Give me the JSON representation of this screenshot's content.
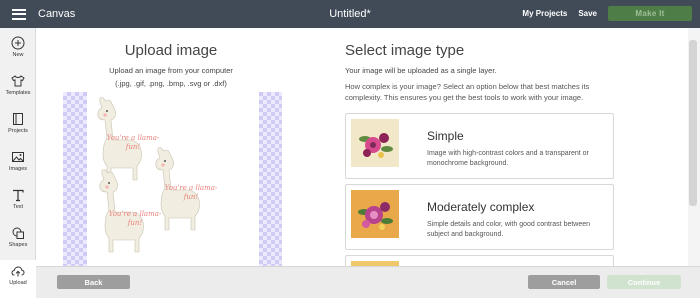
{
  "app": {
    "title": "Canvas",
    "document_title": "Untitled*"
  },
  "header": {
    "my_projects": "My Projects",
    "save": "Save",
    "make_it": "Make It"
  },
  "sidebar": {
    "items": [
      {
        "label": "New",
        "icon": "plus-circle-icon"
      },
      {
        "label": "Templates",
        "icon": "shirt-icon"
      },
      {
        "label": "Projects",
        "icon": "projects-icon"
      },
      {
        "label": "Images",
        "icon": "image-icon"
      },
      {
        "label": "Text",
        "icon": "text-icon"
      },
      {
        "label": "Shapes",
        "icon": "shapes-icon"
      },
      {
        "label": "Upload",
        "icon": "cloud-upload-icon"
      }
    ]
  },
  "upload": {
    "title": "Upload image",
    "subtitle": "Upload an image from your computer",
    "formats": "(.jpg, .gif, .png, .bmp, .svg or .dxf)",
    "preview_text": "You're a llama-fun!"
  },
  "image_type": {
    "title": "Select image type",
    "note": "Your image will be uploaded as a single layer.",
    "description": "How complex is your image? Select an option below that best matches its complexity. This ensures you get the best tools to work with your image.",
    "options": [
      {
        "name": "Simple",
        "description": "Image with high-contrast colors and a transparent or monochrome background."
      },
      {
        "name": "Moderately complex",
        "description": "Simple details and color, with good contrast between subject and background."
      }
    ]
  },
  "footer": {
    "back": "Back",
    "cancel": "Cancel",
    "continue": "Continue"
  },
  "colors": {
    "topbar": "#414b58",
    "make_button": "#4f7d47",
    "checker": "#cfcbf5",
    "button_gray": "#9e9e9e",
    "continue_disabled": "#cfe3cf",
    "option1_thumb": "#f3e7c9",
    "option2_thumb": "#e9a94b",
    "llama_text": "#e8837c"
  }
}
